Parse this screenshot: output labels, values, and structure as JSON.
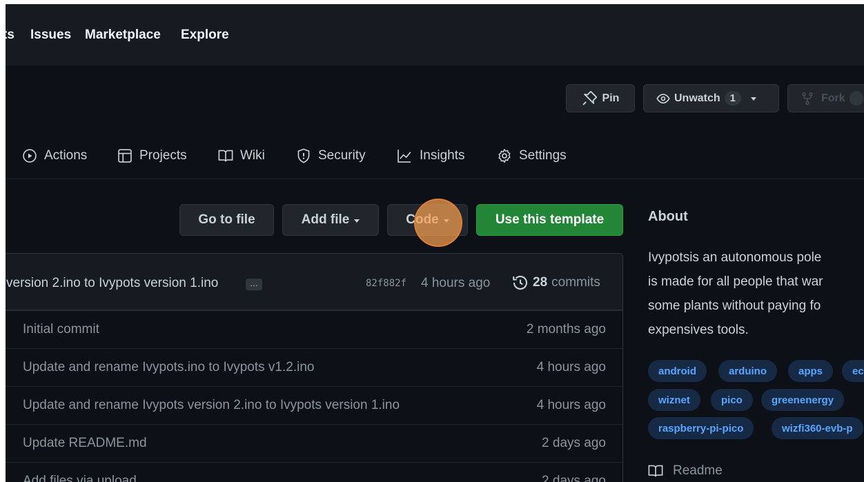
{
  "top_nav": {
    "items": [
      "ts",
      "Issues",
      "Marketplace",
      "Explore"
    ]
  },
  "repo_header": {
    "pin_label": "Pin",
    "unwatch_label": "Unwatch",
    "watch_count": "1",
    "fork_label": "Fork"
  },
  "tabs": {
    "items": [
      "Actions",
      "Projects",
      "Wiki",
      "Security",
      "Insights",
      "Settings"
    ]
  },
  "file_actions": {
    "go_to_file": "Go to file",
    "add_file": "Add file",
    "code": "Code",
    "use_template": "Use this template"
  },
  "latest_commit": {
    "message": "version 2.ino to Ivypots version 1.ino",
    "ellipsis": "…",
    "sha": "82f882f",
    "time": "4 hours ago",
    "commit_count": "28",
    "commits_label": "commits"
  },
  "rows": [
    {
      "message": "Initial commit",
      "age": "2 months ago"
    },
    {
      "message": "Update and rename Ivypots.ino to Ivypots v1.2.ino",
      "age": "4 hours ago"
    },
    {
      "message": "Update and rename Ivypots version 2.ino to Ivypots version 1.ino",
      "age": "4 hours ago"
    },
    {
      "message": "Update README.md",
      "age": "2 days ago"
    },
    {
      "message": "Add files via upload",
      "age": "2 days ago"
    }
  ],
  "about": {
    "title": "About",
    "description_lines": [
      "Ivypotsis an autonomous pole",
      "is made for all people that war",
      "some plants without paying fo",
      "expensives tools."
    ],
    "topics": [
      "android",
      "arduino",
      "apps",
      "ec",
      "wiznet",
      "pico",
      "greenenergy",
      "raspberry-pi-pico",
      "wizfi360-evb-p"
    ],
    "readme_label": "Readme"
  },
  "colors": {
    "background": "#0d1117",
    "header_bg": "#161b22",
    "primary_button": "#238636",
    "topic_bg": "#172a45",
    "topic_text": "#58a6ff",
    "click_highlight": "#f5a050"
  }
}
